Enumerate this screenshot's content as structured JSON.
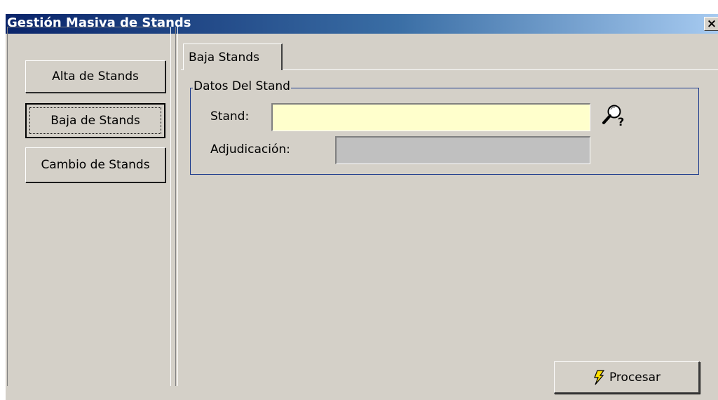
{
  "window": {
    "title": "Gestión Masiva de Stands",
    "close_glyph": "×"
  },
  "sidebar": {
    "buttons": [
      {
        "label": "Alta de Stands"
      },
      {
        "label": "Baja de Stands",
        "focused": true
      },
      {
        "label": "Cambio de Stands"
      }
    ]
  },
  "tabs": [
    {
      "label": "Baja Stands",
      "active": true
    }
  ],
  "group": {
    "legend": "Datos Del Stand",
    "stand_label": "Stand:",
    "stand_value": "",
    "adjudicacion_label": "Adjudicación:",
    "adjudicacion_value": ""
  },
  "icons": {
    "search": "search-question-icon",
    "process": "lightning-icon"
  },
  "actions": {
    "process_label": "Procesar"
  },
  "colors": {
    "stand_field_bg": "#ffffcc",
    "disabled_field_bg": "#c0c0c0",
    "groupbox_border": "#1c3a8c",
    "titlebar_start": "#0a246a"
  }
}
